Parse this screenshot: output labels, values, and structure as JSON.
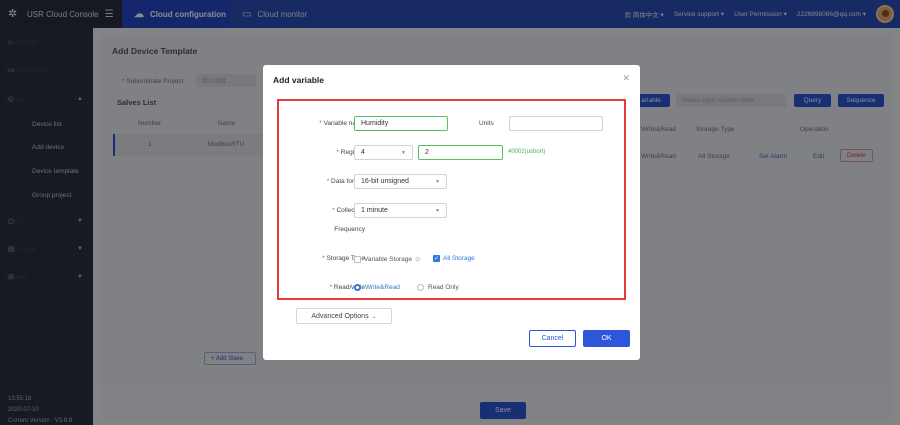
{
  "header": {
    "app_title": "USR Cloud Console",
    "tabs": [
      {
        "label": "Cloud configuration",
        "icon": "cloud-icon"
      },
      {
        "label": "Cloud monitor",
        "icon": "monitor-icon"
      }
    ],
    "language": "简体中文",
    "service_support": "Service support",
    "user_permission": "User Permission",
    "user_email": "2226898066@qq.com"
  },
  "sidebar": {
    "items": [
      {
        "label": "Quick start",
        "icon": "home-icon"
      },
      {
        "label": "Monitor screen",
        "icon": "screen-icon"
      },
      {
        "label": "Device",
        "icon": "device-icon"
      },
      {
        "label": "Alarm",
        "icon": "alarm-icon"
      },
      {
        "label": "Data table",
        "icon": "table-icon"
      },
      {
        "label": "Extend",
        "icon": "extend-icon"
      }
    ],
    "device_sub": [
      "Device list",
      "Add device",
      "Device template",
      "Group project"
    ],
    "footer": {
      "time": "13:55:18",
      "date": "2020-07-10",
      "version": "Current Version : V3.8.8"
    }
  },
  "background": {
    "heading": "Add Device Template",
    "subordinate_label": "* Subordinate Project :",
    "subordinate_value": "默认项目",
    "slaves_title": "Salves List",
    "slaves_cols": [
      "Number",
      "Name"
    ],
    "slave_row": {
      "number": "1",
      "name": "ModbusRTU"
    },
    "add_slave": "+ Add Slave",
    "variable_btn": "ariable",
    "search_placeholder": "Please input variable name",
    "query": "Query",
    "sequence": "Sequence",
    "var_cols": [
      "Write&Read",
      "Storage Type",
      "Operation"
    ],
    "var_row": {
      "rw": "Write&Read",
      "storage": "All Storage",
      "set_alarm": "Set Alarm",
      "edit": "Edit",
      "delete": "Delete"
    },
    "save": "Save"
  },
  "modal": {
    "title": "Add variable",
    "variable_name_label": "Variable name",
    "variable_name_value": "Humidity",
    "units_label": "Units",
    "units_value": "",
    "register_label": "Register",
    "register_type": "4",
    "register_address": "2",
    "register_hint": "40002(ushort)",
    "data_format_label": "Data format",
    "data_format_value": "16-bit unsigned",
    "collection_label_1": "Collection",
    "collection_label_2": "Frequency",
    "collection_value": "1 minute",
    "storage_type_label": "Storage Type",
    "storage_options": [
      {
        "label": "Variable Storage",
        "checked": false
      },
      {
        "label": "All Storage",
        "checked": true
      }
    ],
    "rw_label": "Read/write",
    "rw_options": [
      {
        "label": "Write&Read",
        "selected": true
      },
      {
        "label": "Read Only",
        "selected": false
      }
    ],
    "advanced_label": "Advanced Options",
    "cancel_label": "Cancel",
    "ok_label": "OK"
  },
  "colors": {
    "topbar": "#2d4eb5",
    "sidebar": "#273040",
    "primary": "#2d56d8",
    "highlight": "#e63939",
    "hint": "#49b24a"
  }
}
